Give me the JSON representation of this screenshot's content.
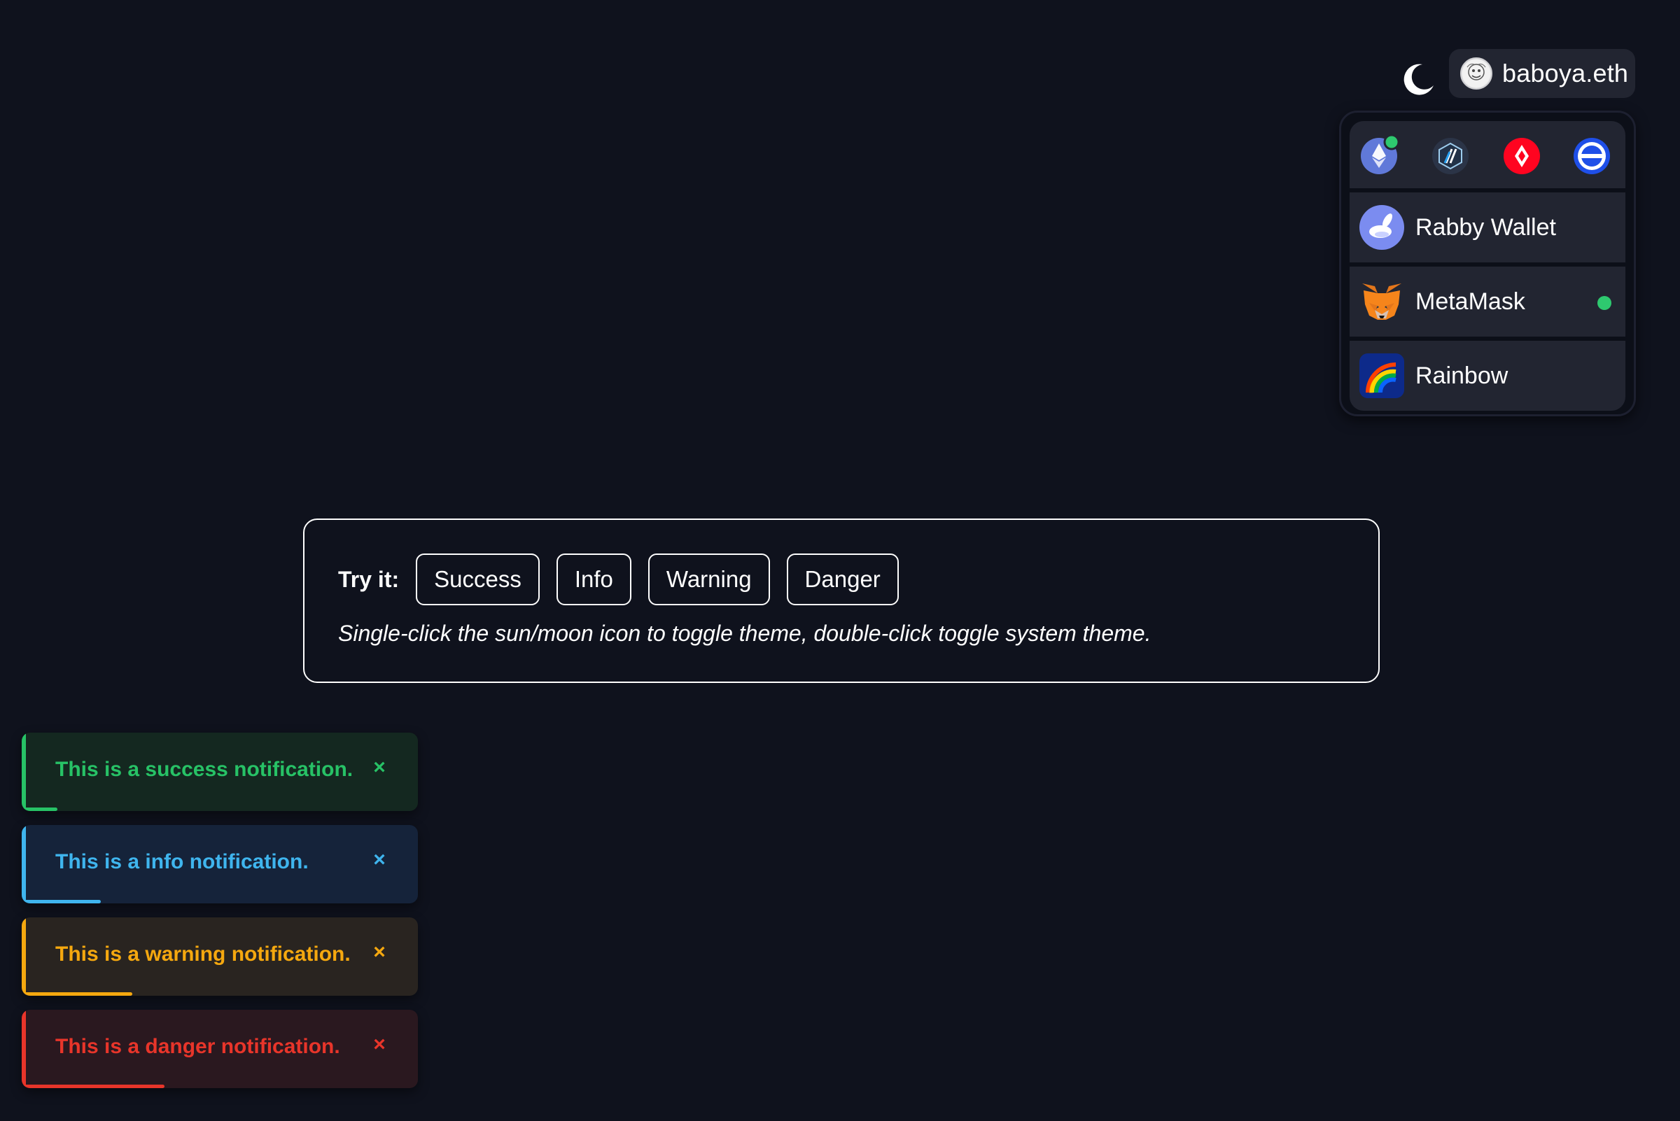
{
  "header": {
    "account_name": "baboya.eth",
    "theme_icon": "moon-icon"
  },
  "wallet_menu": {
    "networks": [
      {
        "name": "ethereum-icon",
        "active": true
      },
      {
        "name": "arbitrum-icon",
        "active": false
      },
      {
        "name": "optimism-icon",
        "active": false
      },
      {
        "name": "base-icon",
        "active": false
      }
    ],
    "wallets": [
      {
        "label": "Rabby Wallet",
        "icon": "rabby-icon",
        "connected": false
      },
      {
        "label": "MetaMask",
        "icon": "metamask-icon",
        "connected": true
      },
      {
        "label": "Rainbow",
        "icon": "rainbow-icon",
        "connected": false
      }
    ]
  },
  "demo": {
    "try_label": "Try it:",
    "buttons": [
      "Success",
      "Info",
      "Warning",
      "Danger"
    ],
    "hint": "Single-click the sun/moon icon to toggle theme, double-click toggle system theme."
  },
  "notifications": [
    {
      "type": "success",
      "message": "This is a success notification.",
      "close": "×",
      "color": "#27c266",
      "background": "#142820",
      "progress": 0.09
    },
    {
      "type": "info",
      "message": "This is a info notification.",
      "close": "×",
      "color": "#3fb5ee",
      "background": "#15233a",
      "progress": 0.2
    },
    {
      "type": "warning",
      "message": "This is a warning notification.",
      "close": "×",
      "color": "#f5a80f",
      "background": "#292420",
      "progress": 0.28
    },
    {
      "type": "danger",
      "message": "This is a danger notification.",
      "close": "×",
      "color": "#e8352a",
      "background": "#2a181f",
      "progress": 0.36
    }
  ]
}
